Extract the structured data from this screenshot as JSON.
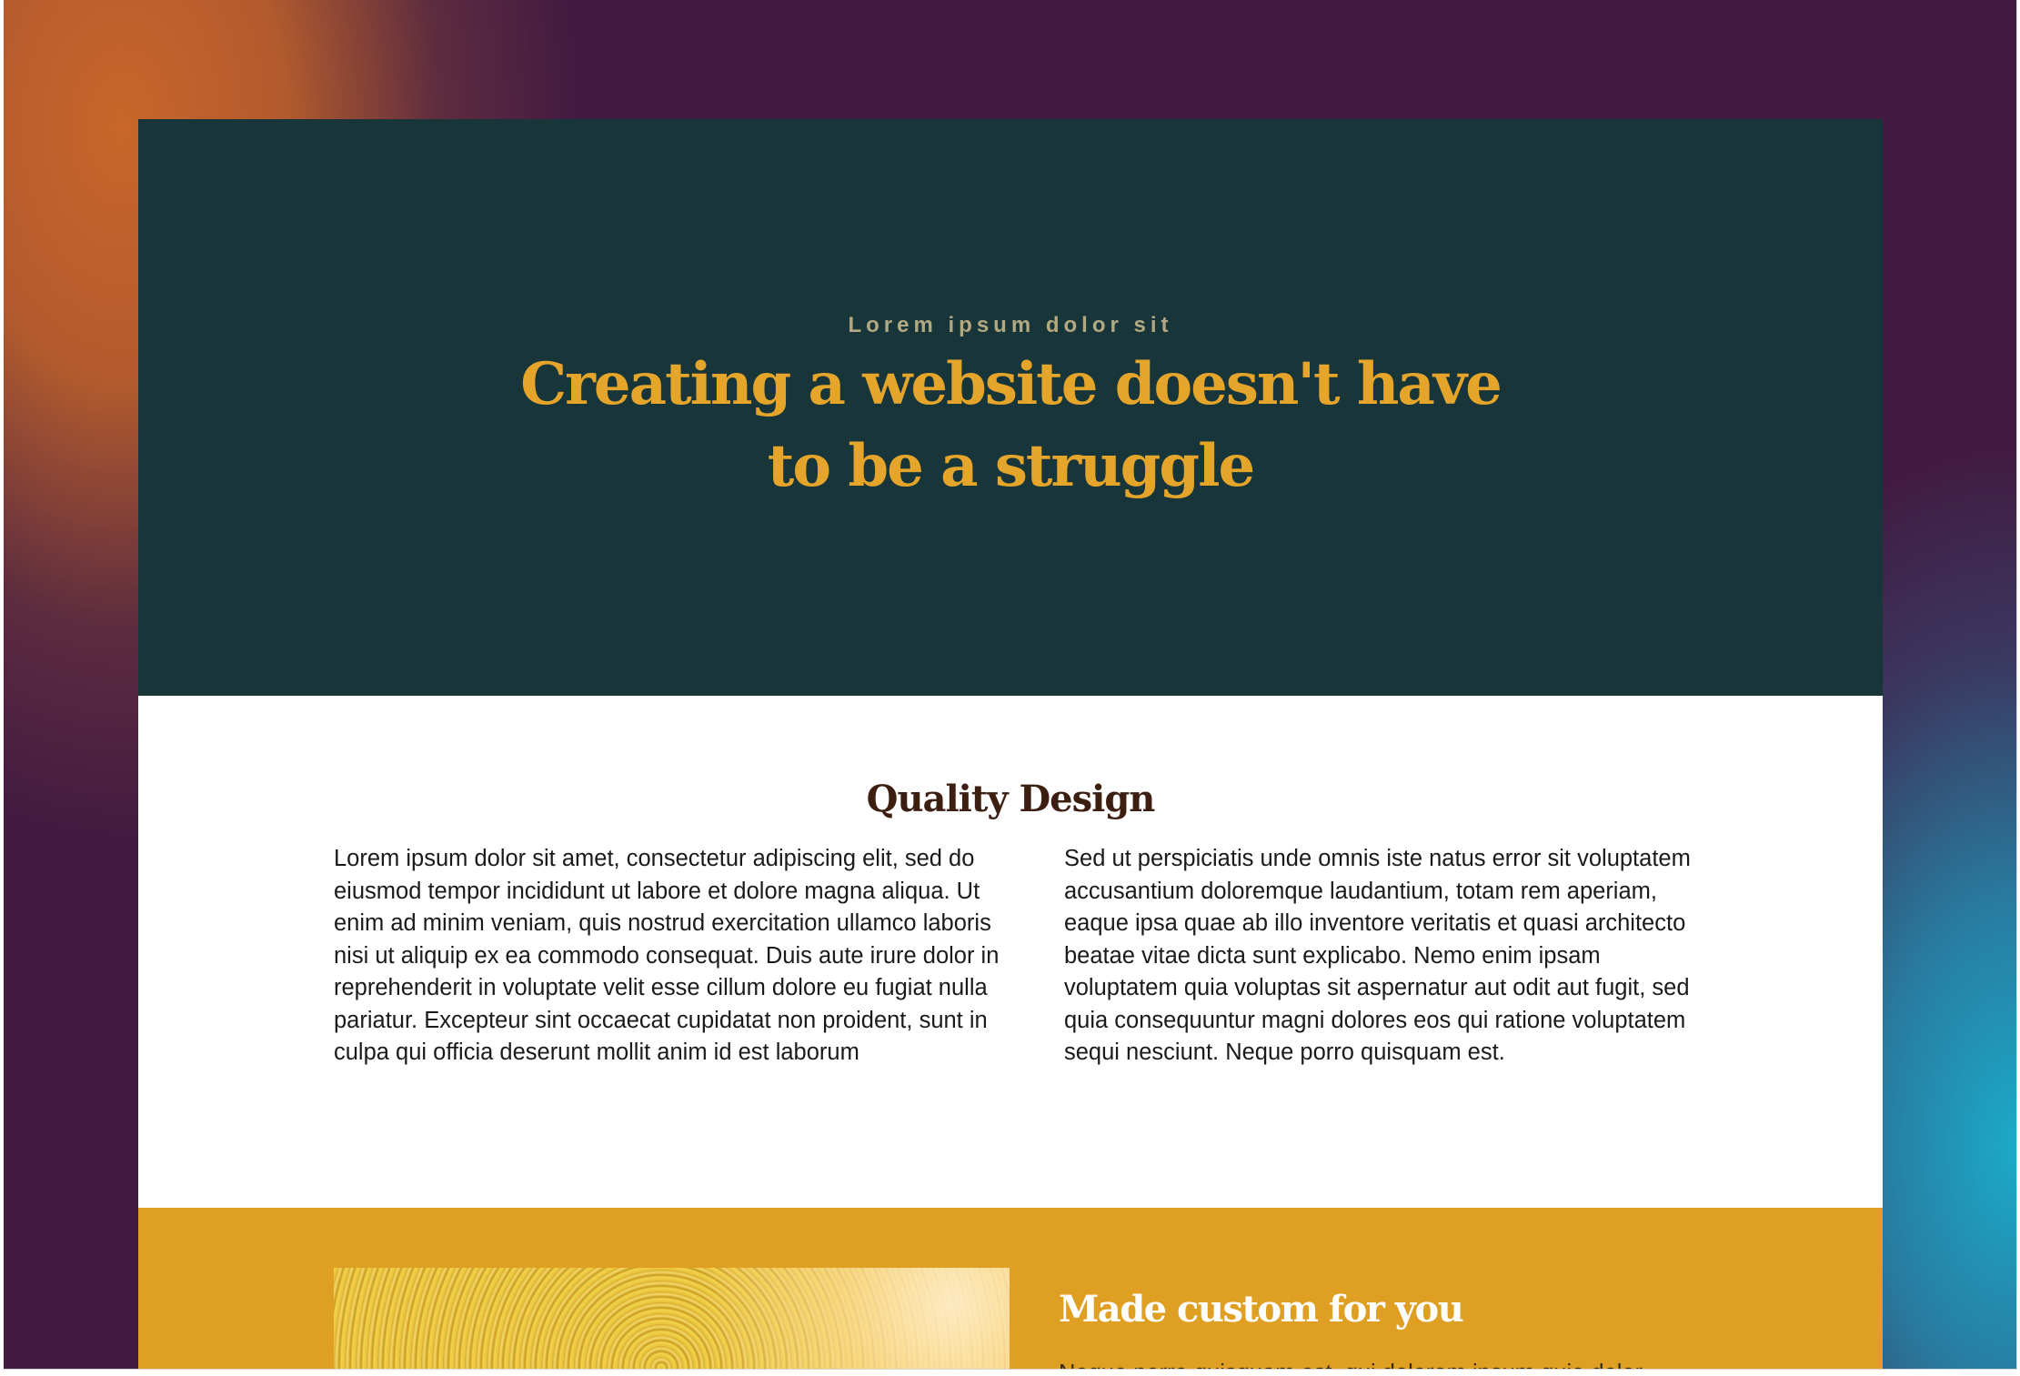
{
  "colors": {
    "hero_background": "#18363a",
    "accent_gold": "#e5a52b",
    "section_gold": "#df9f22",
    "heading_brown": "#3d1f12"
  },
  "hero": {
    "eyebrow": "Lorem ipsum dolor sit",
    "title": "Creating a website doesn't have to be a struggle"
  },
  "quality": {
    "title": "Quality Design",
    "left_text": "Lorem ipsum dolor sit amet, consectetur adipiscing elit, sed do eiusmod tempor incididunt ut labore et dolore magna aliqua. Ut enim ad minim veniam, quis nostrud exercitation ullamco laboris nisi ut aliquip ex ea commodo consequat. Duis aute irure dolor in reprehenderit in voluptate velit esse cillum dolore eu fugiat nulla pariatur. Excepteur sint occaecat cupidatat non proident, sunt in culpa qui officia deserunt mollit anim id est laborum",
    "right_text": "Sed ut perspiciatis unde omnis iste natus error sit voluptatem accusantium doloremque laudantium, totam rem aperiam, eaque ipsa quae ab illo inventore veritatis et quasi architecto beatae vitae dicta sunt explicabo. Nemo enim ipsam voluptatem quia voluptas sit aspernatur aut odit aut fugit, sed quia consequuntur magni dolores eos qui ratione voluptatem sequi nesciunt. Neque porro quisquam est."
  },
  "custom": {
    "title": "Made custom for you",
    "body": "Neque porro quisquam est, qui dolorem ipsum quia dolor"
  }
}
